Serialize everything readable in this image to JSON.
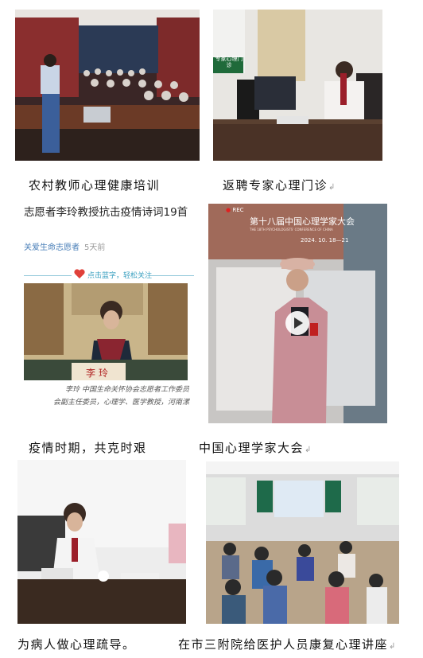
{
  "captions": {
    "c1": "农村教师心理健康培训",
    "c2": "返聘专家心理门诊",
    "c3": "疫情时期，共克时艰",
    "c4": "中国心理学家大会",
    "c5": "为病人做心理疏导。",
    "c6": "在市三附院给医护人员康复心理讲座"
  },
  "paragraph_mark": "↲",
  "article": {
    "title": "志愿者李玲教授抗击疫情诗词19首",
    "author": "关爱生命志愿者",
    "ago": "5天前",
    "follow": "点击蓝字，轻松关注",
    "nameplate": "李玲",
    "caption_line1": "李玲 中国生命关怀协会志愿者工作委员",
    "caption_line2": "会副主任委员，心理学、医学教授，河南漯"
  },
  "clinic_sign": "专家心理门诊",
  "conference": {
    "rec": "REC",
    "banner": "第十八届中国心理学家大会",
    "banner_en": "THE 18TH PSYCHOLOGISTS' CONFERENCE OF CHINA",
    "dates": "2024. 10. 18—21"
  },
  "colors": {
    "accent_red": "#c0392b",
    "link_blue": "#4a7fb8",
    "teal": "#3aa0c0"
  }
}
